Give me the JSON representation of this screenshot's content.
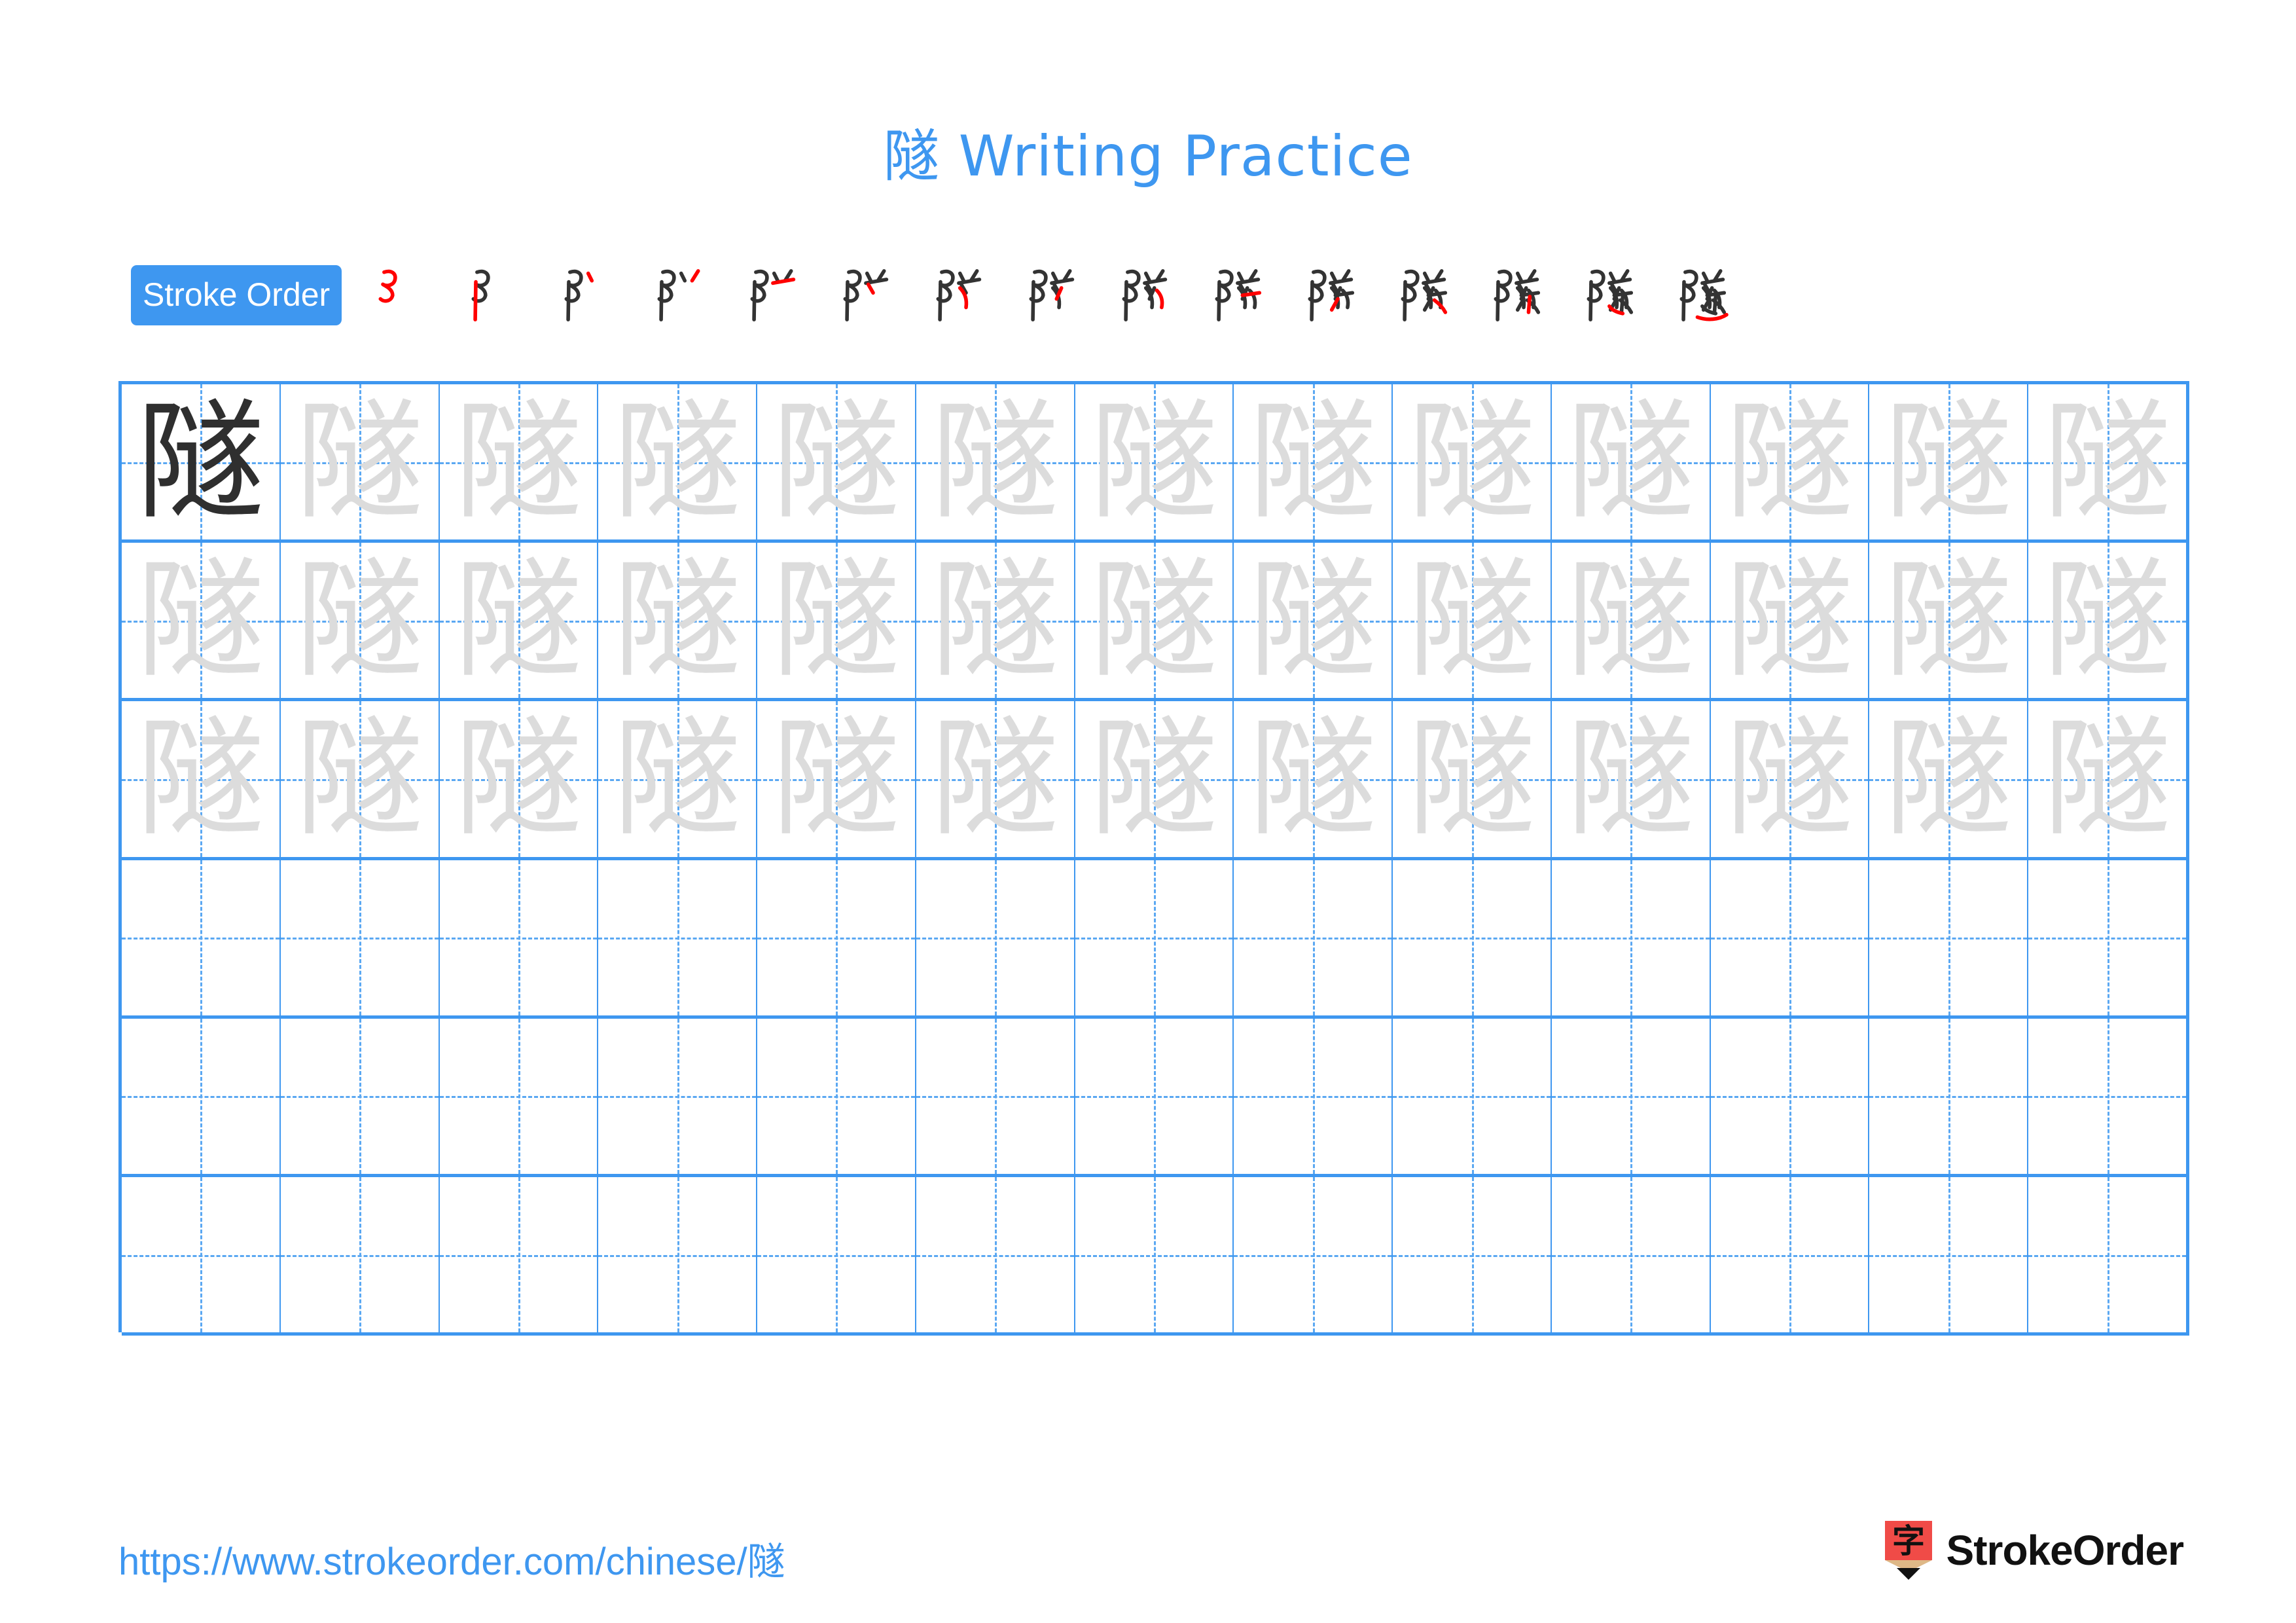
{
  "page": {
    "character": "隧",
    "title_suffix": " Writing Practice",
    "title_full": "隧 Writing Practice",
    "title_color": "#3E97F0",
    "background_color": "#ffffff"
  },
  "stroke_order": {
    "badge_label": "Stroke Order",
    "badge_bg_color": "#3E97F0",
    "badge_text_color": "#ffffff",
    "total_strokes": 15,
    "new_stroke_color": "#FF0000",
    "existing_stroke_color": "#333333",
    "steps": [
      {
        "index": 1,
        "strokes_shown": 1,
        "caption": "㇌"
      },
      {
        "index": 2,
        "strokes_shown": 2,
        "caption": "阝"
      },
      {
        "index": 3,
        "strokes_shown": 3,
        "caption": "阝丶"
      },
      {
        "index": 4,
        "strokes_shown": 4,
        "caption": "阝丷"
      },
      {
        "index": 5,
        "strokes_shown": 5,
        "caption": "阝䒑"
      },
      {
        "index": 6,
        "strokes_shown": 6,
        "caption": "阝丷丿"
      },
      {
        "index": 7,
        "strokes_shown": 7,
        "caption": "阽"
      },
      {
        "index": 8,
        "strokes_shown": 8,
        "caption": "阼"
      },
      {
        "index": 9,
        "strokes_shown": 9,
        "caption": "阴"
      },
      {
        "index": 10,
        "strokes_shown": 10,
        "caption": "陊"
      },
      {
        "index": 11,
        "strokes_shown": 11,
        "caption": "隊"
      },
      {
        "index": 12,
        "strokes_shown": 12,
        "caption": "隊"
      },
      {
        "index": 13,
        "strokes_shown": 13,
        "caption": "隊"
      },
      {
        "index": 14,
        "strokes_shown": 14,
        "caption": "隧"
      },
      {
        "index": 15,
        "strokes_shown": 15,
        "caption": "隧"
      }
    ]
  },
  "practice_grid": {
    "columns": 13,
    "rows": 6,
    "border_color": "#3E97F0",
    "guide_color": "#5BA8F2",
    "solid_char_color": "#2F2F2F",
    "trace_char_color": "#DCDCDC",
    "cells": [
      [
        "solid",
        "trace",
        "trace",
        "trace",
        "trace",
        "trace",
        "trace",
        "trace",
        "trace",
        "trace",
        "trace",
        "trace",
        "trace"
      ],
      [
        "trace",
        "trace",
        "trace",
        "trace",
        "trace",
        "trace",
        "trace",
        "trace",
        "trace",
        "trace",
        "trace",
        "trace",
        "trace"
      ],
      [
        "trace",
        "trace",
        "trace",
        "trace",
        "trace",
        "trace",
        "trace",
        "trace",
        "trace",
        "trace",
        "trace",
        "trace",
        "trace"
      ],
      [
        "empty",
        "empty",
        "empty",
        "empty",
        "empty",
        "empty",
        "empty",
        "empty",
        "empty",
        "empty",
        "empty",
        "empty",
        "empty"
      ],
      [
        "empty",
        "empty",
        "empty",
        "empty",
        "empty",
        "empty",
        "empty",
        "empty",
        "empty",
        "empty",
        "empty",
        "empty",
        "empty"
      ],
      [
        "empty",
        "empty",
        "empty",
        "empty",
        "empty",
        "empty",
        "empty",
        "empty",
        "empty",
        "empty",
        "empty",
        "empty",
        "empty"
      ]
    ]
  },
  "footer": {
    "url": "https://www.strokeorder.com/chinese/隧",
    "url_color": "#3E97F0",
    "brand_name": "StrokeOrder",
    "brand_icon_char": "字",
    "brand_icon_body_color": "#F04B47",
    "brand_icon_wood_color": "#DEB887",
    "brand_icon_tip_color": "#111111"
  }
}
